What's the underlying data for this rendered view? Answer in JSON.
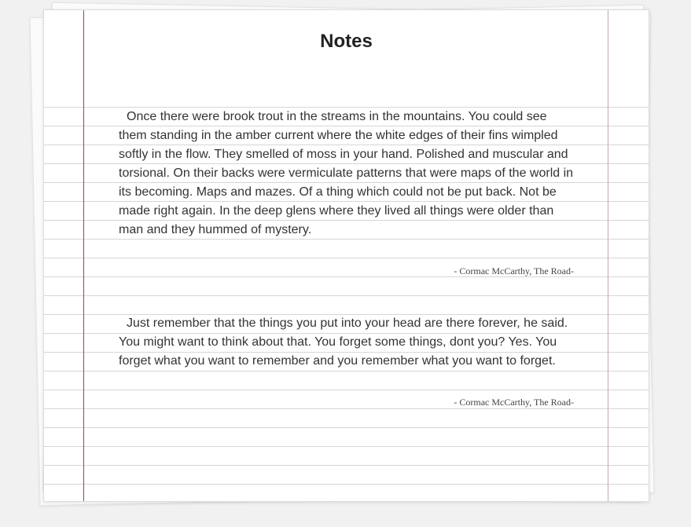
{
  "page": {
    "title": "Notes"
  },
  "notes": [
    {
      "text": "Once there were brook trout in the streams in the mountains. You could see them standing in the amber current where the white edges of their fins wimpled softly in the flow. They smelled of moss in your hand. Polished and muscular and torsional. On their backs were vermiculate patterns that were maps of the world in its becoming. Maps and mazes. Of a thing which could not be put back. Not be made right again. In the deep glens where they lived all things were older than man and they hummed of mystery.",
      "attribution": "-  Cormac McCarthy, The Road-"
    },
    {
      "text": "Just remember that the things you put into your head are there forever, he said. You might want to think about that. You forget some things, dont you? Yes. You forget what you want to remember and you remember what you want to forget.",
      "attribution": "-  Cormac McCarthy, The Road-"
    }
  ],
  "colors": {
    "background": "#f1f1f1",
    "paper": "#ffffff",
    "rule_line": "#d6d6d6",
    "margin_line_left": "#b23a4a",
    "margin_line_right": "#c9a3b4",
    "text": "#333333"
  }
}
